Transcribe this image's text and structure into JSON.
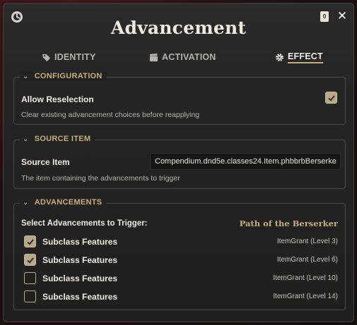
{
  "window": {
    "title": "Advancement",
    "small_button_label": "0",
    "close_symbol": "✕"
  },
  "tabs": [
    {
      "label": "IDENTITY",
      "icon": "tag-icon",
      "active": false
    },
    {
      "label": "ACTIVATION",
      "icon": "clapperboard-icon",
      "active": false
    },
    {
      "label": "EFFECT",
      "icon": "gear-icon",
      "active": true
    }
  ],
  "configuration": {
    "legend": "CONFIGURATION",
    "allow_reselection_label": "Allow Reselection",
    "allow_reselection_checked": true,
    "allow_reselection_hint": "Clear existing advancement choices before reapplying"
  },
  "source_item": {
    "legend": "SOURCE ITEM",
    "label": "Source Item",
    "value": "Compendium.dnd5e.classes24.Item.phbbrbBerserke",
    "hint": "The item containing the advancements to trigger"
  },
  "advancements": {
    "legend": "ADVANCEMENTS",
    "heading": "Select Advancements to Trigger:",
    "class_name": "Path of the Berserker",
    "rows": [
      {
        "label": "Subclass Features",
        "meta": "ItemGrant (Level 3)",
        "checked": true
      },
      {
        "label": "Subclass Features",
        "meta": "ItemGrant (Level 6)",
        "checked": true
      },
      {
        "label": "Subclass Features",
        "meta": "ItemGrant (Level 10)",
        "checked": false
      },
      {
        "label": "Subclass Features",
        "meta": "ItemGrant (Level 14)",
        "checked": false
      }
    ]
  },
  "colors": {
    "accent": "#c9ad7a",
    "checkbox": "#b8a88a",
    "panel": "#242424"
  }
}
